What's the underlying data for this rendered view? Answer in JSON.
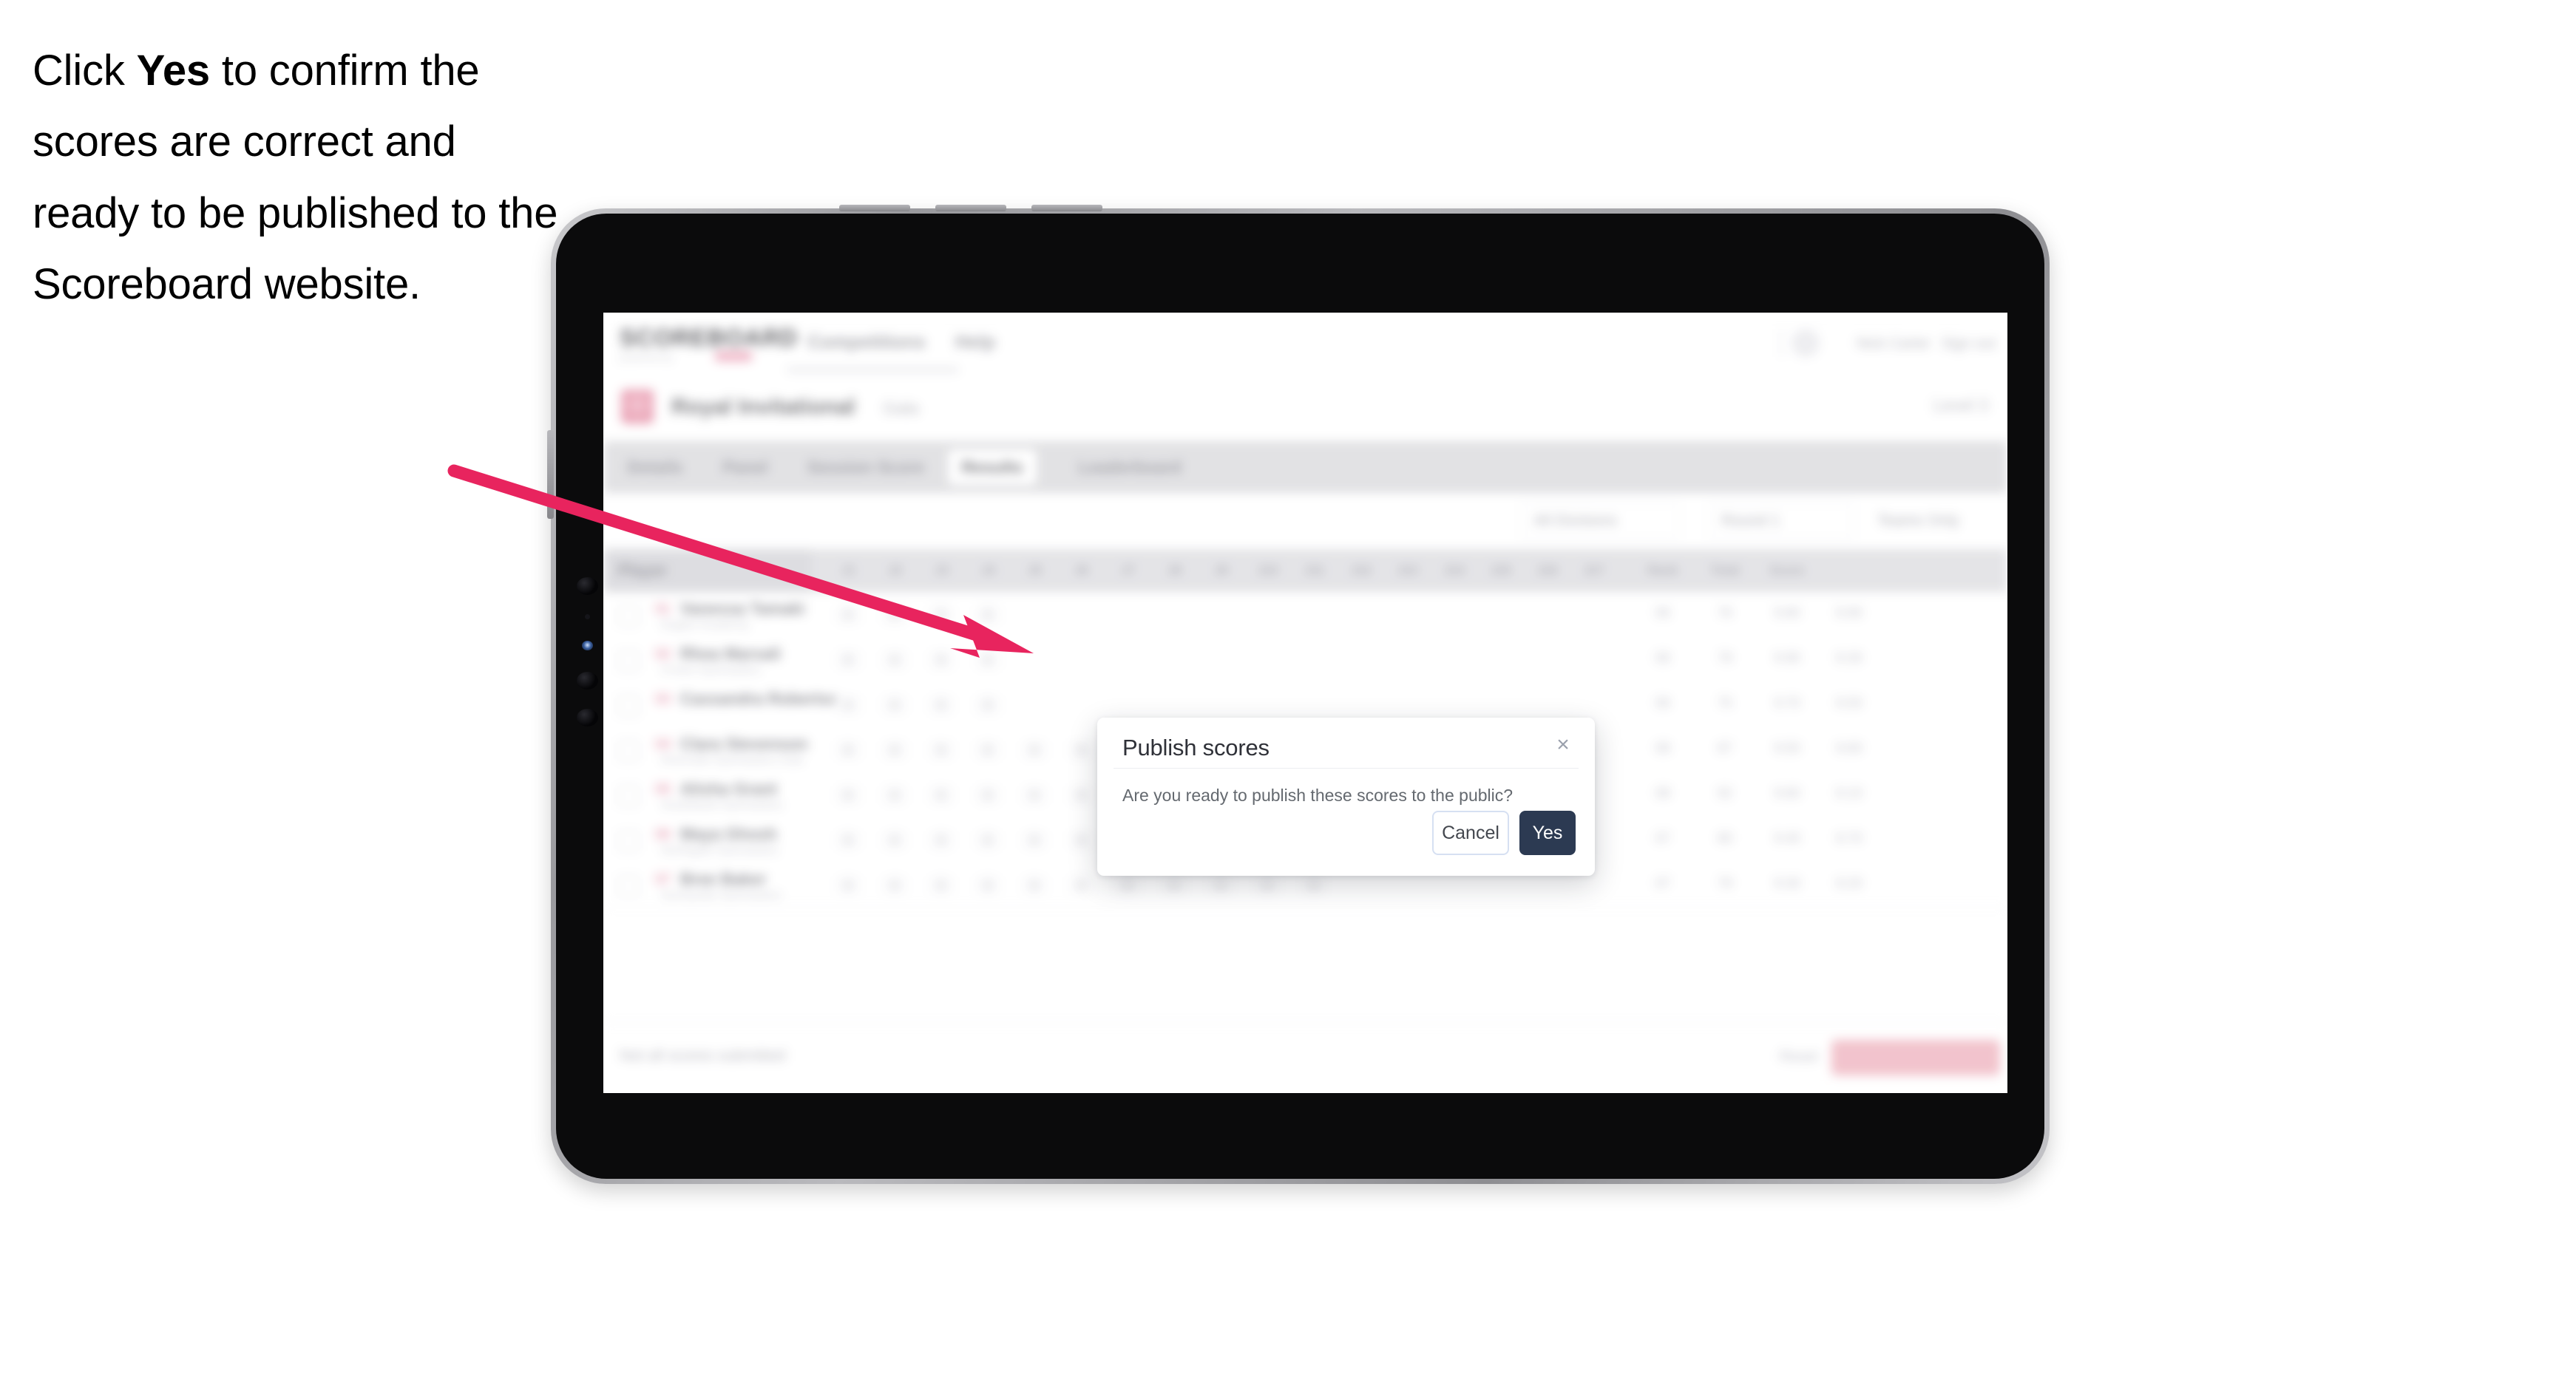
{
  "caption": {
    "before": "Click ",
    "emphasis": "Yes",
    "after": " to confirm the scores are correct and ready to be published to the Scoreboard website."
  },
  "annotation": {
    "arrow_color": "#E8245E",
    "arrow_name": "pointer-arrow-to-yes-button"
  },
  "device": {
    "name": "tablet-device",
    "frame_color": "#a9a9ad",
    "screen_color": "#0b0b0c"
  },
  "app": {
    "header": {
      "logo": "SCOREBOARD",
      "logo_sub": "powered by",
      "nav": [
        {
          "label": "Competitions"
        },
        {
          "label": "Help"
        }
      ],
      "user": "Nick Carter",
      "logout": "Sign out"
    },
    "competition": {
      "title": "Royal Invitational",
      "subtitle": "Gala",
      "right_meta": "Level 3"
    },
    "tabs": [
      {
        "label": "Details",
        "active": false
      },
      {
        "label": "Panel",
        "active": false
      },
      {
        "label": "Session Score",
        "active": false
      },
      {
        "label": "Results",
        "active": true
      },
      {
        "label": "Leaderboard",
        "active": false
      }
    ],
    "filters": [
      {
        "label": "All Divisions"
      },
      {
        "label": "Round 1"
      },
      {
        "label": "Teams Only"
      }
    ],
    "table": {
      "player_header": "Player",
      "score_headers": [
        "J1",
        "J2",
        "J3",
        "J4",
        "J5",
        "J6",
        "J7",
        "J8",
        "J9",
        "J10",
        "J11",
        "J12",
        "J13",
        "J14",
        "J15",
        "J16",
        "J17"
      ],
      "summary_headers": [
        "Rank",
        "Total",
        "Score"
      ],
      "rows": [
        {
          "rank": "01",
          "name": "Vanessa Tamaki",
          "team": "Eagles Academy",
          "scores": [
            "8",
            "8",
            "8",
            "8",
            "",
            "",
            "",
            "",
            "",
            "",
            "",
            "",
            "",
            "",
            "",
            "",
            ""
          ],
          "summary": [
            "06",
            "76",
            "9.80",
            "8.90"
          ]
        },
        {
          "rank": "02",
          "name": "Rhea Marsali",
          "team": "Crown Gymnastics",
          "scores": [
            "8",
            "8",
            "8",
            "8",
            "",
            "",
            "",
            "",
            "",
            "",
            "",
            "",
            "",
            "",
            "",
            "",
            ""
          ],
          "summary": [
            "06",
            "78",
            "9.90",
            "8.30"
          ]
        },
        {
          "rank": "03",
          "name": "Cassandra Robertson",
          "team": "",
          "scores": [
            "8",
            "8",
            "8",
            "8",
            "",
            "",
            "",
            "",
            "",
            "",
            "",
            "",
            "",
            "",
            "",
            "",
            ""
          ],
          "summary": [
            "06",
            "75",
            "9.70",
            "8.50"
          ]
        },
        {
          "rank": "04",
          "name": "Clara Stevenson",
          "team": "Riverside Gymnastics Club",
          "scores": [
            "8",
            "8",
            "8",
            "8",
            "8",
            "8",
            "8",
            "8",
            "8",
            "8",
            "8",
            "8",
            "",
            "",
            "",
            "",
            ""
          ],
          "summary": [
            "08",
            "87",
            "9.50",
            "8.60"
          ]
        },
        {
          "rank": "05",
          "name": "Alisha Grant",
          "team": "Southbank Gymnastics",
          "scores": [
            "8",
            "8",
            "8",
            "8",
            "8",
            "8",
            "8",
            "8",
            "8",
            "8",
            "8",
            "8",
            "8",
            "",
            "",
            "",
            ""
          ],
          "summary": [
            "08",
            "92",
            "9.60",
            "8.10"
          ]
        },
        {
          "rank": "06",
          "name": "Maya Ghosh",
          "team": "Northgate Gymnastics",
          "scores": [
            "8",
            "8",
            "8",
            "8",
            "8",
            "8",
            "8",
            "8",
            "8",
            "8",
            "8",
            "8",
            "",
            "",
            "",
            "",
            ""
          ],
          "summary": [
            "07",
            "80",
            "9.40",
            "8.70"
          ]
        },
        {
          "rank": "07",
          "name": "Bree Baker",
          "team": "Sunnyside Gymnastics",
          "scores": [
            "8",
            "8",
            "8",
            "8",
            "8",
            "8",
            "8",
            "8",
            "8",
            "8",
            "8",
            "",
            "",
            "",
            "",
            "",
            ""
          ],
          "summary": [
            "07",
            "79",
            "9.30",
            "8.20"
          ]
        }
      ]
    },
    "footer": {
      "note": "Not all scores submitted",
      "link": "Reset",
      "grey_button": "Save",
      "pink_button": "Publish all scores"
    }
  },
  "modal": {
    "title": "Publish scores",
    "close_icon": "×",
    "body": "Are you ready to publish these scores to the public?",
    "cancel_label": "Cancel",
    "confirm_label": "Yes",
    "confirm_color": "#2C3A52"
  }
}
